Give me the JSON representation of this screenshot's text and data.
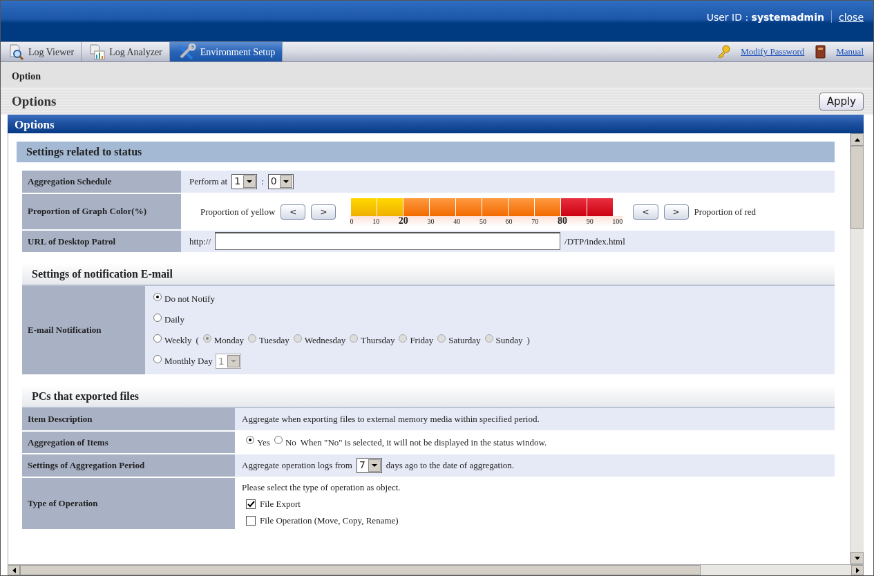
{
  "header": {
    "user_label": "User ID :",
    "user_id": "systemadmin",
    "close_link": "close"
  },
  "tabs": [
    {
      "label": "Log Viewer",
      "selected": false
    },
    {
      "label": "Log Analyzer",
      "selected": false
    },
    {
      "label": "Environment Setup",
      "selected": true
    }
  ],
  "links": [
    "Modify Password",
    "Manual"
  ],
  "breadcrumb": "Option",
  "page_title": "Options",
  "apply_button": "Apply",
  "panel_title": "Options",
  "sections": [
    {
      "title": "Settings related to status",
      "rows": [
        {
          "kind": "schedule",
          "label": "Aggregation Schedule",
          "prefix": "Perform at",
          "hour": "1",
          "separator": ":",
          "minute": "0"
        },
        {
          "kind": "graph",
          "label": "Proportion of Graph Color(%)",
          "yellow_label": "Proportion of yellow",
          "red_label": "Proportion of red",
          "yellow_buttons": [
            "<",
            ">"
          ],
          "red_buttons": [
            "<",
            ">"
          ],
          "yellow_share": {
            "level": 0.2
          },
          "red_start": {
            "level": 0.8
          },
          "ticks": [
            {
              "text": "0",
              "emphasized": false
            },
            {
              "text": "10",
              "emphasized": false
            },
            {
              "text": "20",
              "emphasized": true
            },
            {
              "text": "30",
              "emphasized": false
            },
            {
              "text": "40",
              "emphasized": false
            },
            {
              "text": "50",
              "emphasized": false
            },
            {
              "text": "60",
              "emphasized": false
            },
            {
              "text": "70",
              "emphasized": false
            },
            {
              "text": "80",
              "emphasized": true
            },
            {
              "text": "90",
              "emphasized": false
            },
            {
              "text": "100",
              "emphasized": false
            }
          ]
        },
        {
          "kind": "url",
          "label": "URL of Desktop Patrol",
          "prefix": "http://",
          "suffix": "/DTP/index.html"
        }
      ]
    },
    {
      "title": "Settings of notification E-mail",
      "rows": [
        {
          "kind": "radios",
          "label": "E-mail Notification",
          "options": [
            {
              "label": "Do not Notify",
              "selected": true
            },
            {
              "label": "Daily",
              "selected": false
            },
            {
              "label": "Weekly",
              "selected": false,
              "open": "(",
              "close": ")",
              "days": [
                {
                  "label": "Monday",
                  "selected": true,
                  "disabled": true
                },
                {
                  "label": "Tuesday",
                  "selected": false,
                  "disabled": true
                },
                {
                  "label": "Wednesday",
                  "selected": false,
                  "disabled": true
                },
                {
                  "label": "Thursday",
                  "selected": false,
                  "disabled": true
                },
                {
                  "label": "Friday",
                  "selected": false,
                  "disabled": true
                },
                {
                  "label": "Saturday",
                  "selected": false,
                  "disabled": true
                },
                {
                  "label": "Sunday",
                  "selected": false,
                  "disabled": true
                }
              ]
            },
            {
              "label": "Monthly Day",
              "selected": false,
              "day": {
                "value": "1",
                "disabled": true
              }
            }
          ]
        }
      ]
    },
    {
      "title": "PCs that exported files",
      "rows": [
        {
          "kind": "text",
          "label": "Item Description",
          "value": "Aggregate when exporting files to external memory media within specified period."
        },
        {
          "kind": "yesno",
          "label": "Aggregation of Items",
          "options": [
            {
              "label": "Yes",
              "selected": true
            },
            {
              "label": "No",
              "selected": false
            }
          ],
          "note": "When \"No\" is selected, it will not be displayed in the status window."
        },
        {
          "kind": "period",
          "label": "Settings of Aggregation Period",
          "prefix": "Aggregate operation logs from",
          "value": "7",
          "suffix": "days ago to the date of aggregation."
        },
        {
          "kind": "checklist",
          "label": "Type of Operation",
          "intro": "Please select the type of operation as object.",
          "items": [
            {
              "label": "File Export",
              "checked": true
            },
            {
              "label": "File Operation (Move, Copy, Rename)",
              "checked": false
            }
          ]
        }
      ]
    }
  ]
}
